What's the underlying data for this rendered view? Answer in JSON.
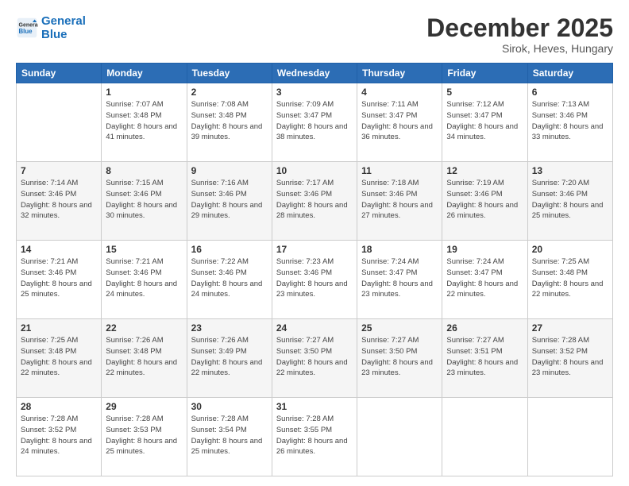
{
  "logo": {
    "line1": "General",
    "line2": "Blue"
  },
  "header": {
    "month": "December 2025",
    "location": "Sirok, Heves, Hungary"
  },
  "weekdays": [
    "Sunday",
    "Monday",
    "Tuesday",
    "Wednesday",
    "Thursday",
    "Friday",
    "Saturday"
  ],
  "weeks": [
    [
      {
        "day": "",
        "sunrise": "",
        "sunset": "",
        "daylight": ""
      },
      {
        "day": "1",
        "sunrise": "Sunrise: 7:07 AM",
        "sunset": "Sunset: 3:48 PM",
        "daylight": "Daylight: 8 hours and 41 minutes."
      },
      {
        "day": "2",
        "sunrise": "Sunrise: 7:08 AM",
        "sunset": "Sunset: 3:48 PM",
        "daylight": "Daylight: 8 hours and 39 minutes."
      },
      {
        "day": "3",
        "sunrise": "Sunrise: 7:09 AM",
        "sunset": "Sunset: 3:47 PM",
        "daylight": "Daylight: 8 hours and 38 minutes."
      },
      {
        "day": "4",
        "sunrise": "Sunrise: 7:11 AM",
        "sunset": "Sunset: 3:47 PM",
        "daylight": "Daylight: 8 hours and 36 minutes."
      },
      {
        "day": "5",
        "sunrise": "Sunrise: 7:12 AM",
        "sunset": "Sunset: 3:47 PM",
        "daylight": "Daylight: 8 hours and 34 minutes."
      },
      {
        "day": "6",
        "sunrise": "Sunrise: 7:13 AM",
        "sunset": "Sunset: 3:46 PM",
        "daylight": "Daylight: 8 hours and 33 minutes."
      }
    ],
    [
      {
        "day": "7",
        "sunrise": "Sunrise: 7:14 AM",
        "sunset": "Sunset: 3:46 PM",
        "daylight": "Daylight: 8 hours and 32 minutes."
      },
      {
        "day": "8",
        "sunrise": "Sunrise: 7:15 AM",
        "sunset": "Sunset: 3:46 PM",
        "daylight": "Daylight: 8 hours and 30 minutes."
      },
      {
        "day": "9",
        "sunrise": "Sunrise: 7:16 AM",
        "sunset": "Sunset: 3:46 PM",
        "daylight": "Daylight: 8 hours and 29 minutes."
      },
      {
        "day": "10",
        "sunrise": "Sunrise: 7:17 AM",
        "sunset": "Sunset: 3:46 PM",
        "daylight": "Daylight: 8 hours and 28 minutes."
      },
      {
        "day": "11",
        "sunrise": "Sunrise: 7:18 AM",
        "sunset": "Sunset: 3:46 PM",
        "daylight": "Daylight: 8 hours and 27 minutes."
      },
      {
        "day": "12",
        "sunrise": "Sunrise: 7:19 AM",
        "sunset": "Sunset: 3:46 PM",
        "daylight": "Daylight: 8 hours and 26 minutes."
      },
      {
        "day": "13",
        "sunrise": "Sunrise: 7:20 AM",
        "sunset": "Sunset: 3:46 PM",
        "daylight": "Daylight: 8 hours and 25 minutes."
      }
    ],
    [
      {
        "day": "14",
        "sunrise": "Sunrise: 7:21 AM",
        "sunset": "Sunset: 3:46 PM",
        "daylight": "Daylight: 8 hours and 25 minutes."
      },
      {
        "day": "15",
        "sunrise": "Sunrise: 7:21 AM",
        "sunset": "Sunset: 3:46 PM",
        "daylight": "Daylight: 8 hours and 24 minutes."
      },
      {
        "day": "16",
        "sunrise": "Sunrise: 7:22 AM",
        "sunset": "Sunset: 3:46 PM",
        "daylight": "Daylight: 8 hours and 24 minutes."
      },
      {
        "day": "17",
        "sunrise": "Sunrise: 7:23 AM",
        "sunset": "Sunset: 3:46 PM",
        "daylight": "Daylight: 8 hours and 23 minutes."
      },
      {
        "day": "18",
        "sunrise": "Sunrise: 7:24 AM",
        "sunset": "Sunset: 3:47 PM",
        "daylight": "Daylight: 8 hours and 23 minutes."
      },
      {
        "day": "19",
        "sunrise": "Sunrise: 7:24 AM",
        "sunset": "Sunset: 3:47 PM",
        "daylight": "Daylight: 8 hours and 22 minutes."
      },
      {
        "day": "20",
        "sunrise": "Sunrise: 7:25 AM",
        "sunset": "Sunset: 3:48 PM",
        "daylight": "Daylight: 8 hours and 22 minutes."
      }
    ],
    [
      {
        "day": "21",
        "sunrise": "Sunrise: 7:25 AM",
        "sunset": "Sunset: 3:48 PM",
        "daylight": "Daylight: 8 hours and 22 minutes."
      },
      {
        "day": "22",
        "sunrise": "Sunrise: 7:26 AM",
        "sunset": "Sunset: 3:48 PM",
        "daylight": "Daylight: 8 hours and 22 minutes."
      },
      {
        "day": "23",
        "sunrise": "Sunrise: 7:26 AM",
        "sunset": "Sunset: 3:49 PM",
        "daylight": "Daylight: 8 hours and 22 minutes."
      },
      {
        "day": "24",
        "sunrise": "Sunrise: 7:27 AM",
        "sunset": "Sunset: 3:50 PM",
        "daylight": "Daylight: 8 hours and 22 minutes."
      },
      {
        "day": "25",
        "sunrise": "Sunrise: 7:27 AM",
        "sunset": "Sunset: 3:50 PM",
        "daylight": "Daylight: 8 hours and 23 minutes."
      },
      {
        "day": "26",
        "sunrise": "Sunrise: 7:27 AM",
        "sunset": "Sunset: 3:51 PM",
        "daylight": "Daylight: 8 hours and 23 minutes."
      },
      {
        "day": "27",
        "sunrise": "Sunrise: 7:28 AM",
        "sunset": "Sunset: 3:52 PM",
        "daylight": "Daylight: 8 hours and 23 minutes."
      }
    ],
    [
      {
        "day": "28",
        "sunrise": "Sunrise: 7:28 AM",
        "sunset": "Sunset: 3:52 PM",
        "daylight": "Daylight: 8 hours and 24 minutes."
      },
      {
        "day": "29",
        "sunrise": "Sunrise: 7:28 AM",
        "sunset": "Sunset: 3:53 PM",
        "daylight": "Daylight: 8 hours and 25 minutes."
      },
      {
        "day": "30",
        "sunrise": "Sunrise: 7:28 AM",
        "sunset": "Sunset: 3:54 PM",
        "daylight": "Daylight: 8 hours and 25 minutes."
      },
      {
        "day": "31",
        "sunrise": "Sunrise: 7:28 AM",
        "sunset": "Sunset: 3:55 PM",
        "daylight": "Daylight: 8 hours and 26 minutes."
      },
      {
        "day": "",
        "sunrise": "",
        "sunset": "",
        "daylight": ""
      },
      {
        "day": "",
        "sunrise": "",
        "sunset": "",
        "daylight": ""
      },
      {
        "day": "",
        "sunrise": "",
        "sunset": "",
        "daylight": ""
      }
    ]
  ]
}
